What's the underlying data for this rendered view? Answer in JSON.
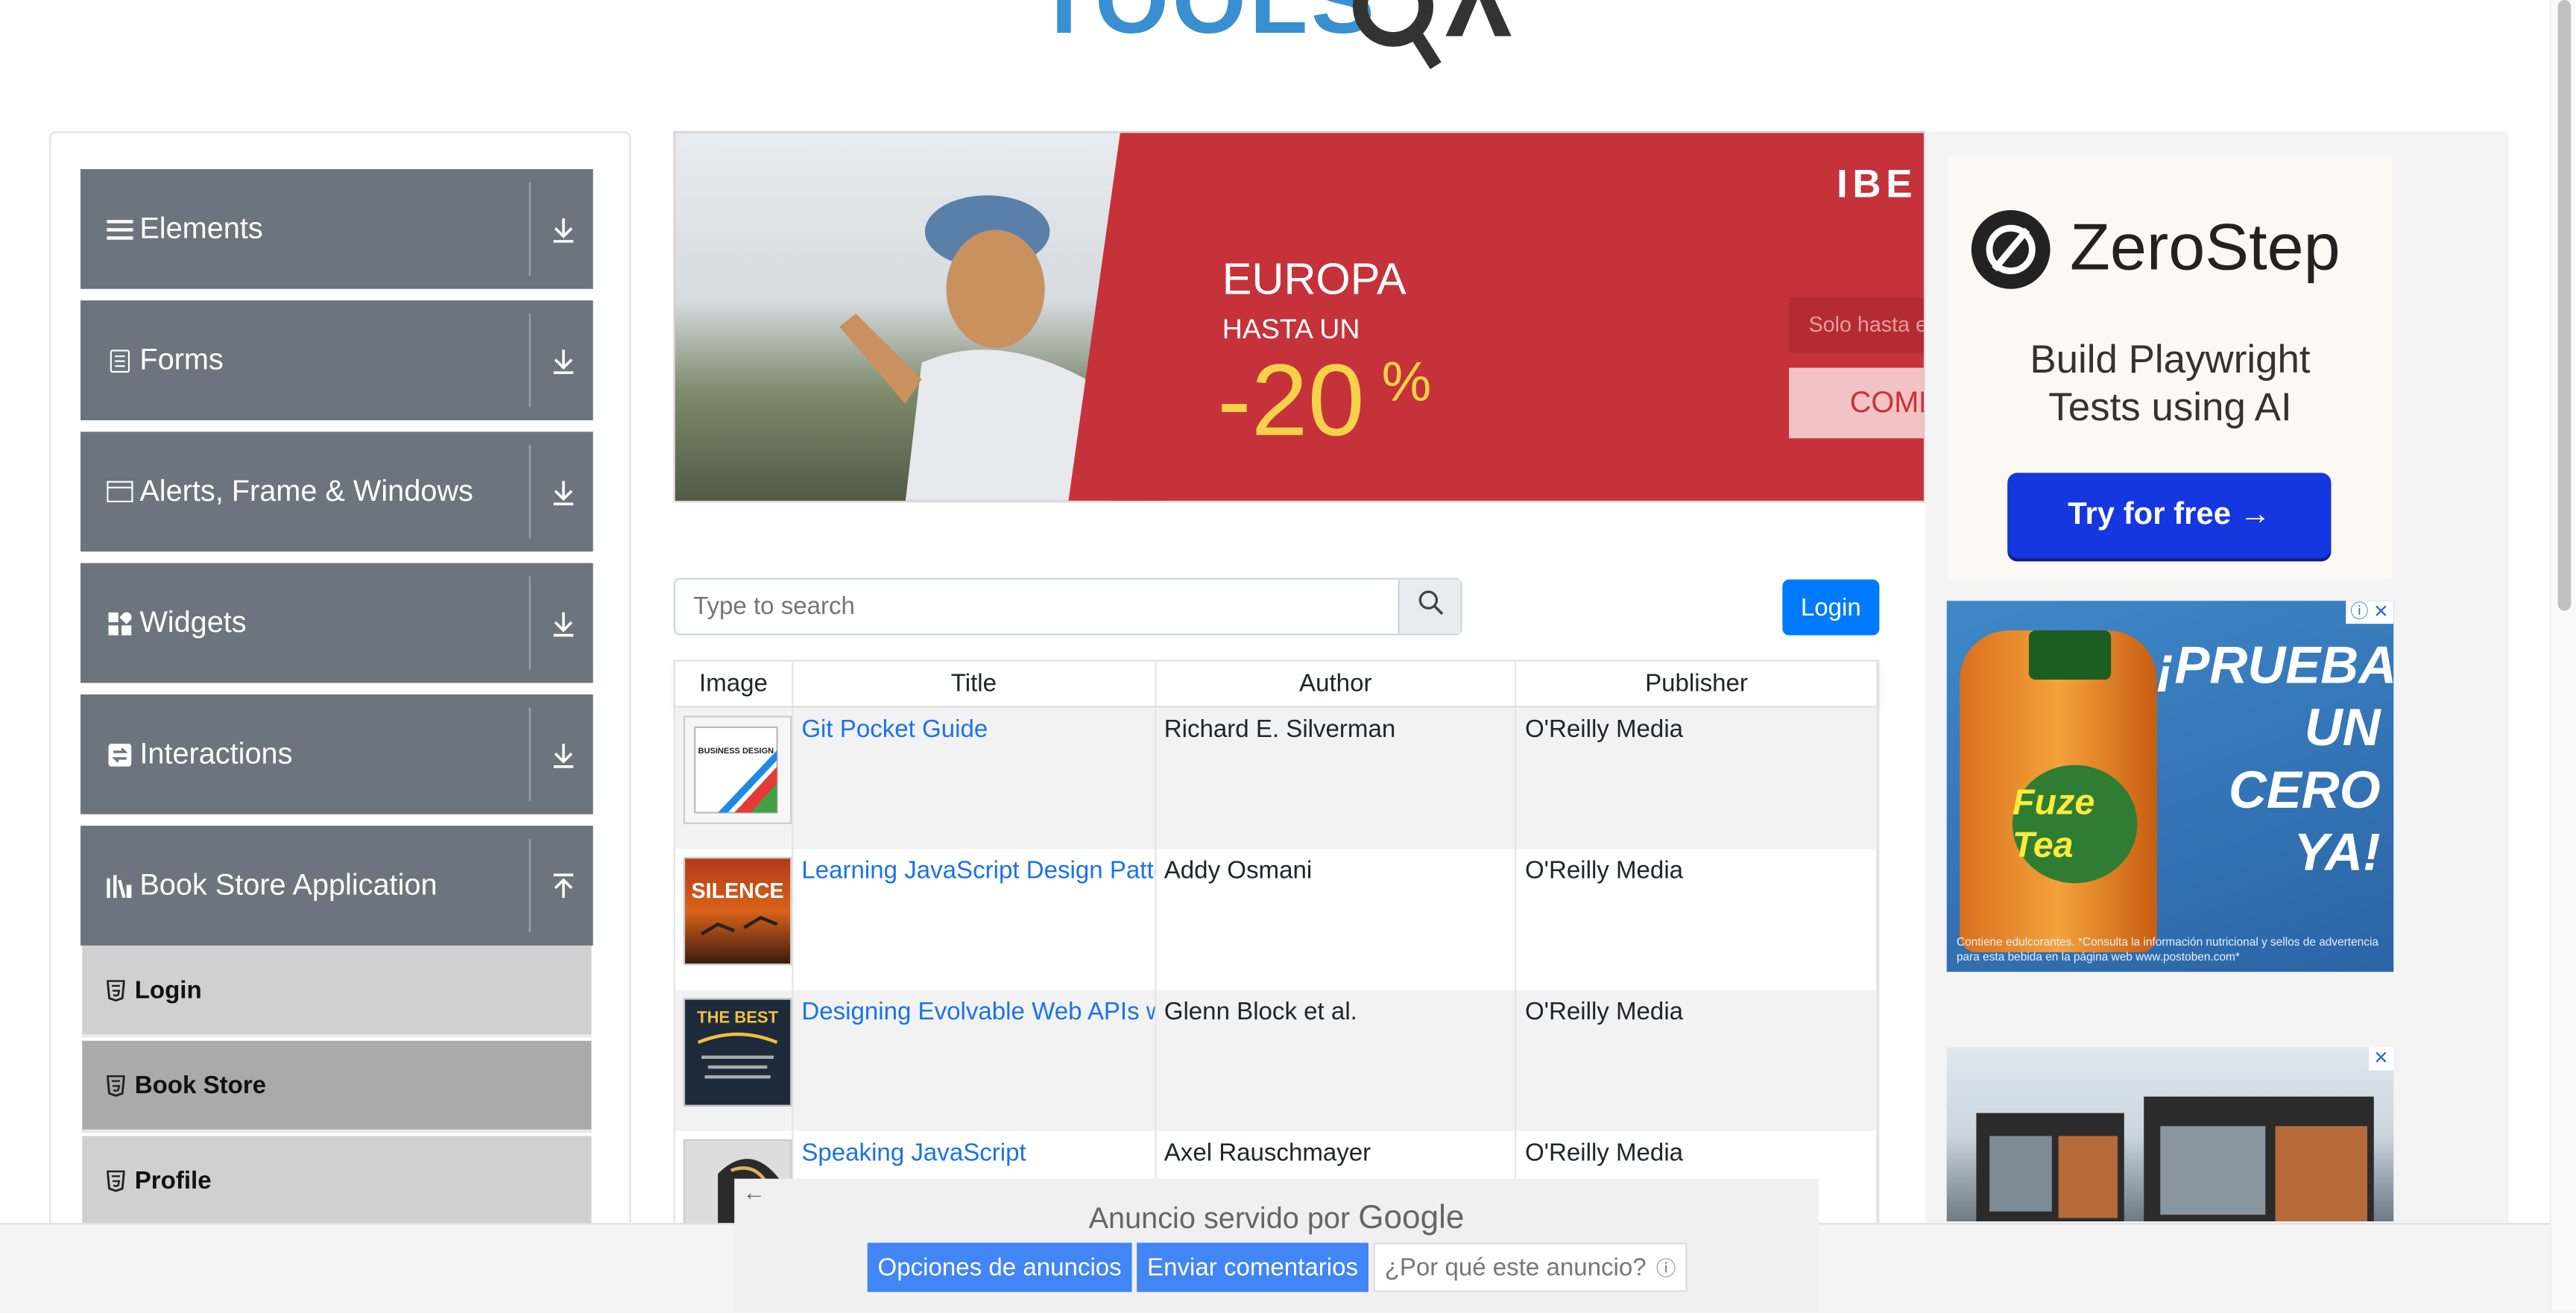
{
  "logo": {
    "text": "TOOLSQA"
  },
  "sidebar": {
    "groups": [
      {
        "label": "Elements",
        "icon": "list-icon",
        "arrow": "download-arrow-icon"
      },
      {
        "label": "Forms",
        "icon": "form-icon",
        "arrow": "download-arrow-icon"
      },
      {
        "label": "Alerts, Frame & Windows",
        "icon": "window-icon",
        "arrow": "download-arrow-icon"
      },
      {
        "label": "Widgets",
        "icon": "widgets-icon",
        "arrow": "download-arrow-icon"
      },
      {
        "label": "Interactions",
        "icon": "interactions-icon",
        "arrow": "download-arrow-icon"
      },
      {
        "label": "Book Store Application",
        "icon": "library-icon",
        "arrow": "upload-arrow-icon"
      }
    ],
    "book_store_items": [
      {
        "label": "Login"
      },
      {
        "label": "Book Store",
        "active": true
      },
      {
        "label": "Profile"
      }
    ]
  },
  "top_ad": {
    "brand": "IBE",
    "headline": "EUROPA",
    "subhead": "HASTA UN",
    "discount": "-20",
    "percent": "%",
    "field_text": "Solo hasta e",
    "cta": "COMP"
  },
  "search": {
    "placeholder": "Type to search"
  },
  "login_button": "Login",
  "table": {
    "columns": [
      "Image",
      "Title",
      "Author",
      "Publisher"
    ],
    "rows": [
      {
        "title": "Git Pocket Guide",
        "author": "Richard E. Silverman",
        "publisher": "O'Reilly Media",
        "cover_text": "BUSINESS DESIGN"
      },
      {
        "title": "Learning JavaScript Design Patterns",
        "author": "Addy Osmani",
        "publisher": "O'Reilly Media",
        "cover_text": "SILENCE"
      },
      {
        "title": "Designing Evolvable Web APIs with ASP.NET",
        "author": "Glenn Block et al.",
        "publisher": "O'Reilly Media",
        "cover_text": "THE BEST"
      },
      {
        "title": "Speaking JavaScript",
        "author": "Axel Rauschmayer",
        "publisher": "O'Reilly Media",
        "cover_text": ""
      }
    ]
  },
  "zerostep_ad": {
    "brand": "ZeroStep",
    "desc_line1": "Build Playwright",
    "desc_line2": "Tests using AI",
    "button": "Try for free →"
  },
  "tea_ad": {
    "headline": "¡PRUEBA UN CERO YA!",
    "label": "Fuze Tea",
    "fine_print": "Contiene edulcorantes. *Consulta la información nutricional y sellos de advertencia para esta bebida en la página web www.postoben.com*"
  },
  "google_footer": {
    "served_prefix": "Anuncio servido por",
    "served_brand": "Google",
    "options_button": "Opciones de anuncios",
    "send_button": "Enviar comentarios",
    "why_button": "¿Por qué este anuncio?"
  },
  "colors": {
    "sidebar_group": "#6c757d",
    "primary": "#007bff",
    "link": "#1a73e8",
    "ad_red": "#c6323a"
  }
}
